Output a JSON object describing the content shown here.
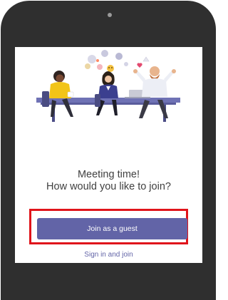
{
  "prompt": {
    "line1": "Meeting time!",
    "line2": "How would you like to join?"
  },
  "actions": {
    "join_as_guest": "Join as a guest",
    "sign_in_and_join": "Sign in and join"
  },
  "colors": {
    "accent": "#6264a7",
    "highlight": "#e0141b",
    "phone_frame": "#2f2f2f"
  },
  "icons": [
    "speech-bubble-icon",
    "emoji-icon",
    "heart-icon",
    "laptop-icon"
  ]
}
